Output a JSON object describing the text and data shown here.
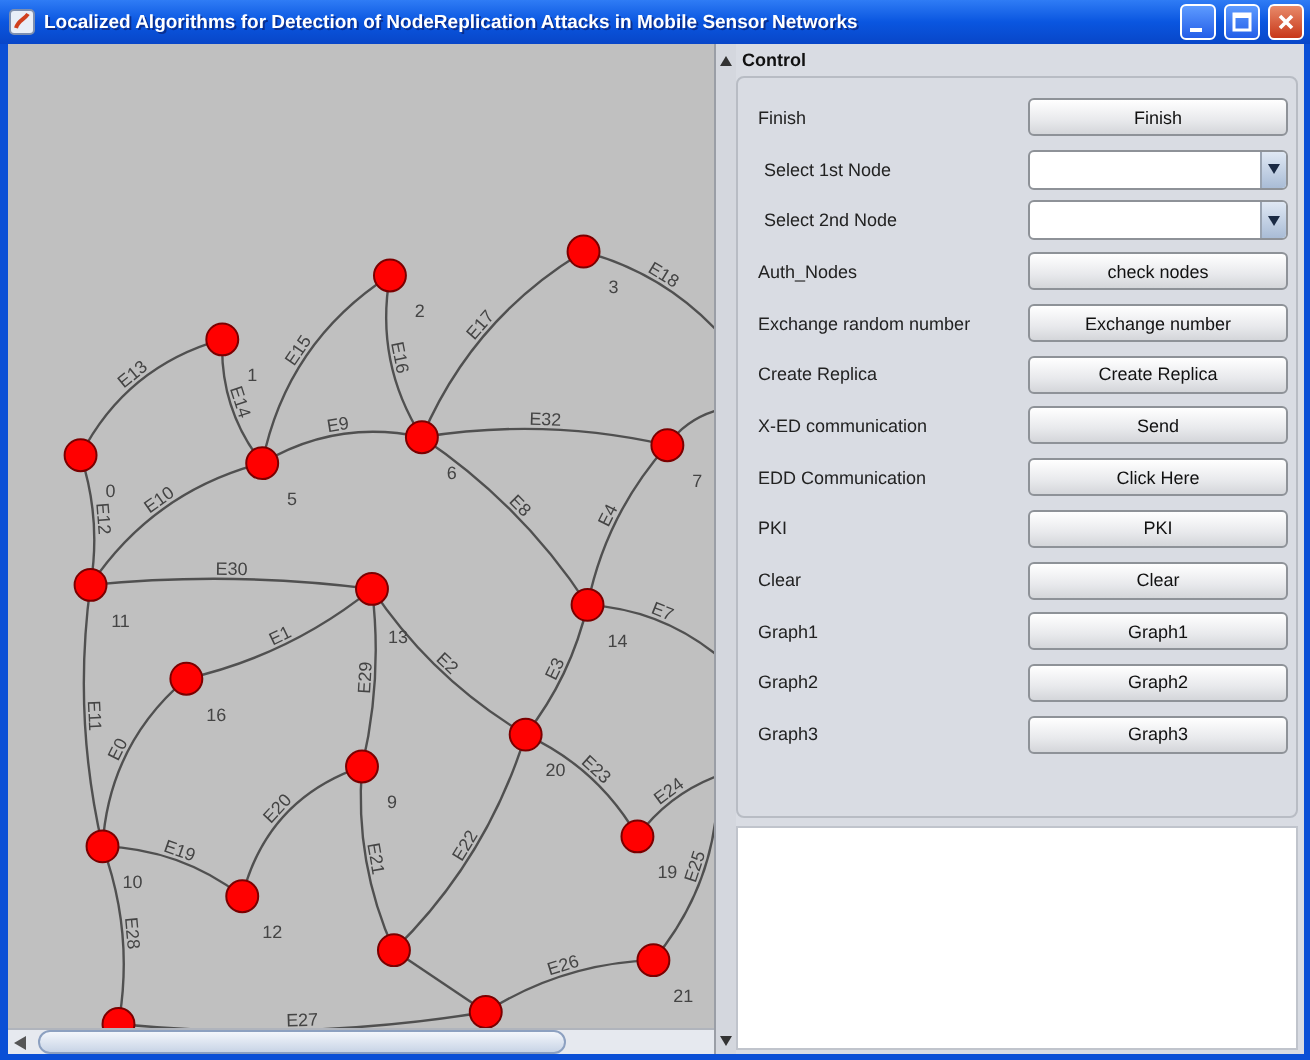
{
  "window": {
    "title": "Localized Algorithms for Detection of NodeReplication Attacks in Mobile Sensor Networks"
  },
  "graph": {
    "nodes": [
      {
        "kind": "node",
        "label": "3"
      },
      {
        "kind": "node",
        "label": "2"
      },
      {
        "kind": "node",
        "label": "1"
      },
      {
        "kind": "node",
        "label": "6"
      },
      {
        "kind": "node",
        "label": "7"
      },
      {
        "kind": "node",
        "label": "0"
      },
      {
        "kind": "node",
        "label": "5"
      },
      {
        "kind": "node",
        "label": "11"
      },
      {
        "kind": "node",
        "label": "13"
      },
      {
        "kind": "node",
        "label": "14"
      },
      {
        "kind": "node",
        "label": "16"
      },
      {
        "kind": "node",
        "label": "20"
      },
      {
        "kind": "node",
        "label": "9"
      },
      {
        "kind": "node",
        "label": "19"
      },
      {
        "kind": "node",
        "label": "10"
      },
      {
        "kind": "node",
        "label": "12"
      },
      {
        "kind": "node"
      },
      {
        "kind": "node",
        "label": "21"
      },
      {
        "kind": "node"
      },
      {
        "kind": "node"
      }
    ],
    "edges": [
      {
        "label": "E18"
      },
      {
        "label": "E17"
      },
      {
        "label": "E15"
      },
      {
        "label": "E16"
      },
      {
        "label": "E13"
      },
      {
        "label": "E14"
      },
      {
        "label": "E9"
      },
      {
        "label": "E32"
      },
      {
        "label": "E12"
      },
      {
        "label": "E10"
      },
      {
        "label": "E8"
      },
      {
        "label": "E4"
      },
      {
        "label": "E30"
      },
      {
        "label": "E7"
      },
      {
        "label": "E1"
      },
      {
        "label": "E29"
      },
      {
        "label": "E2"
      },
      {
        "label": "E3"
      },
      {
        "label": "E11"
      },
      {
        "label": "E0"
      },
      {
        "label": "E23"
      },
      {
        "label": "E24"
      },
      {
        "label": "E20"
      },
      {
        "label": "E21"
      },
      {
        "label": "E22"
      },
      {
        "label": "E19"
      },
      {
        "label": "E25"
      },
      {
        "label": "E28"
      },
      {
        "label": "E26"
      },
      {
        "label": "E27"
      }
    ]
  },
  "control": {
    "title": "Control",
    "rows": [
      {
        "kind": "button",
        "label": "Finish",
        "button": "Finish"
      },
      {
        "kind": "select",
        "label": "Select 1st Node"
      },
      {
        "kind": "select",
        "label": "Select 2nd Node"
      },
      {
        "kind": "button",
        "label": "Auth_Nodes",
        "button": "check nodes"
      },
      {
        "kind": "button",
        "label": "Exchange random number",
        "button": "Exchange number"
      },
      {
        "kind": "button",
        "label": "Create Replica",
        "button": "Create Replica"
      },
      {
        "kind": "button",
        "label": "X-ED communication",
        "button": "Send"
      },
      {
        "kind": "button",
        "label": "EDD Communication",
        "button": "Click Here"
      },
      {
        "kind": "button",
        "label": "PKI",
        "button": "PKI"
      },
      {
        "kind": "button",
        "label": "Clear",
        "button": "Clear"
      },
      {
        "kind": "button",
        "label": "Graph1",
        "button": "Graph1"
      },
      {
        "kind": "button",
        "label": "Graph2",
        "button": "Graph2"
      },
      {
        "kind": "button",
        "label": "Graph3",
        "button": "Graph3"
      }
    ]
  }
}
